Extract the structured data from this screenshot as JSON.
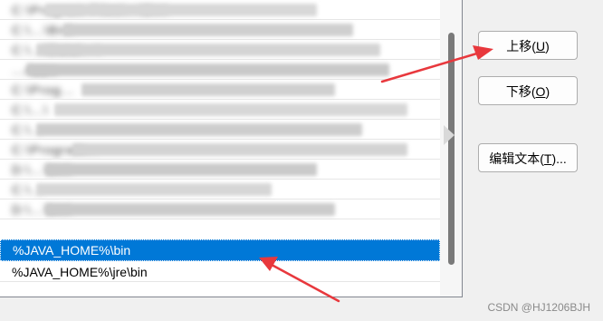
{
  "list": {
    "items": [
      {
        "text": "C:\\Program Files\\...\\Bin\\",
        "blurred": true
      },
      {
        "text": "C:\\...\\Bin\\",
        "blurred": true
      },
      {
        "text": "C:\\...\\Data\\...\\",
        "blurred": true
      },
      {
        "text": "...Apps",
        "blurred": true
      },
      {
        "text": "C:\\Prog...",
        "blurred": true
      },
      {
        "text": "C:\\...\\",
        "blurred": true
      },
      {
        "text": "C:\\...",
        "blurred": true
      },
      {
        "text": "C:\\Program...",
        "blurred": true
      },
      {
        "text": "D:\\...\\bin\\",
        "blurred": true
      },
      {
        "text": "C:\\...",
        "blurred": true
      },
      {
        "text": "D:\\...\\bin\\",
        "blurred": true
      },
      {
        "text": "%JAVA_HOME%\\bin",
        "blurred": false,
        "selected": true
      },
      {
        "text": "%JAVA_HOME%\\jre\\bin",
        "blurred": false,
        "selected": false
      }
    ]
  },
  "buttons": {
    "move_up": {
      "label": "上移(",
      "key": "U",
      "suffix": ")"
    },
    "move_down": {
      "label": "下移(",
      "key": "O",
      "suffix": ")"
    },
    "edit_text": {
      "label": "编辑文本(",
      "key": "T",
      "suffix": ")..."
    }
  },
  "annotation_color": "#e8383d",
  "selection_color": "#0078d7",
  "watermark": "CSDN @HJ1206BJH"
}
